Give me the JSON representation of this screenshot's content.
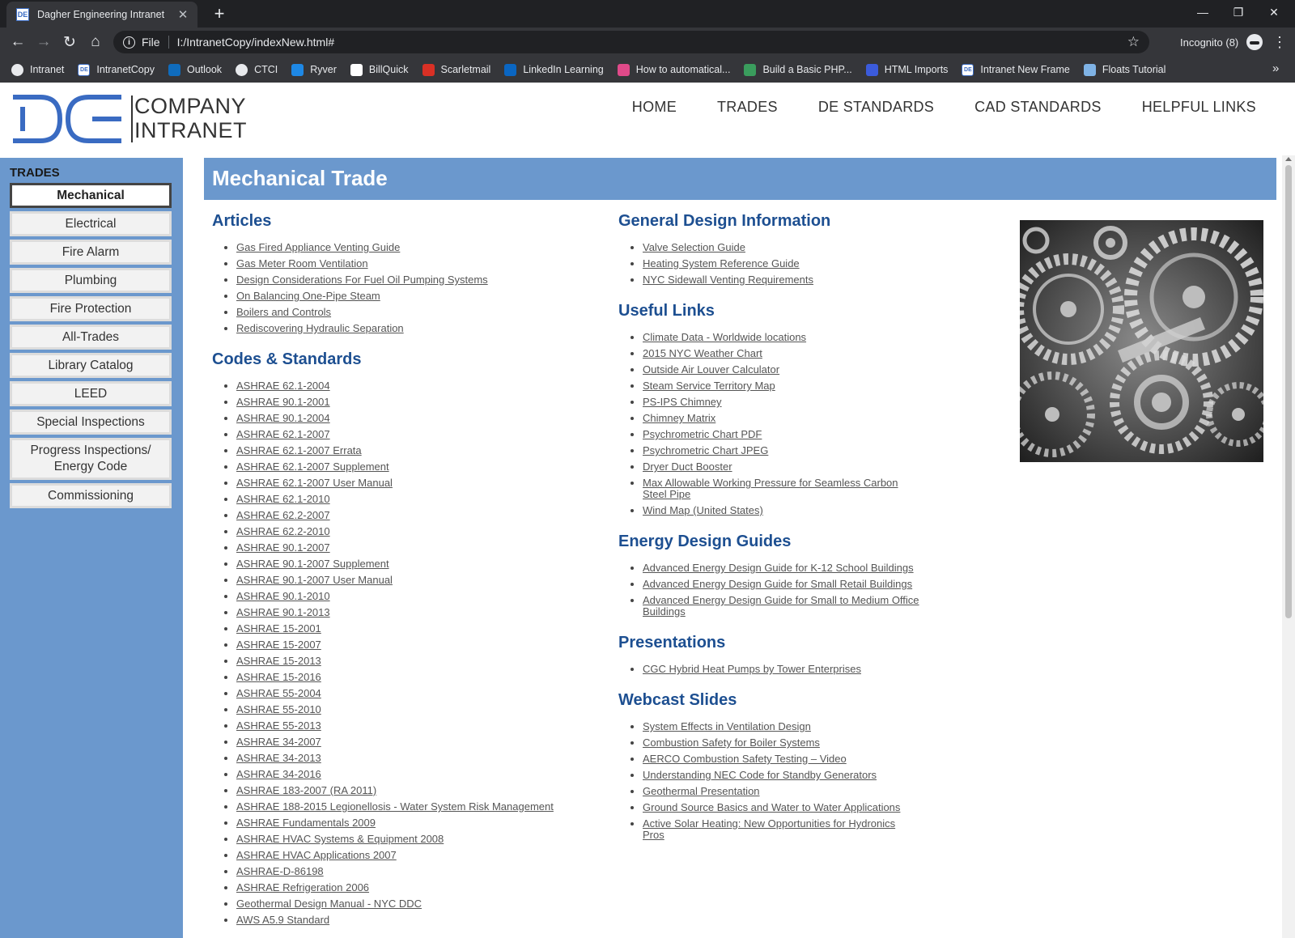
{
  "browser": {
    "tab_title": "Dagher Engineering Intranet",
    "favicon_text": "DE",
    "scheme_label": "File",
    "url": "I:/IntranetCopy/indexNew.html#",
    "incognito_label": "Incognito (8)"
  },
  "bookmarks": [
    {
      "label": "Intranet",
      "icon": "globe-icon",
      "color": "#e8eaed"
    },
    {
      "label": "IntranetCopy",
      "icon": "de-logo-icon",
      "color": "#ffffff"
    },
    {
      "label": "Outlook",
      "icon": "outlook-icon",
      "color": "#0f6cbd"
    },
    {
      "label": "CTCI",
      "icon": "globe-icon",
      "color": "#e8eaed"
    },
    {
      "label": "Ryver",
      "icon": "ryver-icon",
      "color": "#1e88e5"
    },
    {
      "label": "BillQuick",
      "icon": "billquick-icon",
      "color": "#ffffff"
    },
    {
      "label": "Scarletmail",
      "icon": "gmail-icon",
      "color": "#d93025"
    },
    {
      "label": "LinkedIn Learning",
      "icon": "linkedin-icon",
      "color": "#0a66c2"
    },
    {
      "label": "How to automatical...",
      "icon": "swirl-icon",
      "color": "#e04a8a"
    },
    {
      "label": "Build a Basic PHP...",
      "icon": "php-icon",
      "color": "#3a9d5d"
    },
    {
      "label": "HTML Imports",
      "icon": "html5-icon",
      "color": "#3b5bdb"
    },
    {
      "label": "Intranet New Frame",
      "icon": "de-logo-icon",
      "color": "#ffffff"
    },
    {
      "label": "Floats Tutorial",
      "icon": "floats-icon",
      "color": "#7fb3e6"
    }
  ],
  "logo": {
    "line1": "COMPANY",
    "line2": "INTRANET",
    "accent": "#3a6bc2"
  },
  "topnav": [
    "HOME",
    "TRADES",
    "DE STANDARDS",
    "CAD STANDARDS",
    "HELPFUL LINKS"
  ],
  "sidebar": {
    "title": "TRADES",
    "items": [
      {
        "label": "Mechanical",
        "active": true
      },
      {
        "label": "Electrical"
      },
      {
        "label": "Fire Alarm"
      },
      {
        "label": "Plumbing"
      },
      {
        "label": "Fire Protection"
      },
      {
        "label": "All-Trades"
      },
      {
        "label": "Library Catalog"
      },
      {
        "label": "LEED"
      },
      {
        "label": "Special Inspections"
      },
      {
        "label": "Progress Inspections/ Energy Code"
      },
      {
        "label": "Commissioning"
      }
    ]
  },
  "main": {
    "title": "Mechanical Trade",
    "accent": "#6b98cd",
    "heading_color": "#1d4f91",
    "col1": [
      {
        "heading": "Articles",
        "links": [
          "Gas Fired Appliance Venting Guide",
          "Gas Meter Room Ventilation",
          "Design Considerations For Fuel Oil Pumping Systems",
          "On Balancing One-Pipe Steam",
          "Boilers and Controls",
          "Rediscovering Hydraulic Separation"
        ]
      },
      {
        "heading": "Codes & Standards",
        "links": [
          "ASHRAE 62.1-2004",
          "ASHRAE 90.1-2001",
          "ASHRAE 90.1-2004",
          "ASHRAE 62.1-2007",
          "ASHRAE 62.1-2007 Errata",
          "ASHRAE 62.1-2007 Supplement",
          "ASHRAE 62.1-2007 User Manual",
          "ASHRAE 62.1-2010",
          "ASHRAE 62.2-2007",
          "ASHRAE 62.2-2010",
          "ASHRAE 90.1-2007",
          "ASHRAE 90.1-2007 Supplement",
          "ASHRAE 90.1-2007 User Manual",
          "ASHRAE 90.1-2010",
          "ASHRAE 90.1-2013",
          "ASHRAE 15-2001",
          "ASHRAE 15-2007",
          "ASHRAE 15-2013",
          "ASHRAE 15-2016",
          "ASHRAE 55-2004",
          "ASHRAE 55-2010",
          "ASHRAE 55-2013",
          "ASHRAE 34-2007",
          "ASHRAE 34-2013",
          "ASHRAE 34-2016",
          "ASHRAE 183-2007 (RA 2011)",
          "ASHRAE 188-2015 Legionellosis - Water System Risk Management",
          "ASHRAE Fundamentals 2009",
          "ASHRAE HVAC Systems & Equipment 2008",
          "ASHRAE HVAC Applications 2007",
          "ASHRAE-D-86198",
          "ASHRAE Refrigeration 2006",
          "Geothermal Design Manual - NYC DDC",
          "AWS A5.9 Standard"
        ]
      }
    ],
    "col2": [
      {
        "heading": "General Design Information",
        "links": [
          "Valve Selection Guide",
          "Heating System Reference Guide",
          "NYC Sidewall Venting Requirements"
        ]
      },
      {
        "heading": "Useful Links",
        "links": [
          "Climate Data - Worldwide locations",
          "2015 NYC Weather Chart",
          "Outside Air Louver Calculator",
          "Steam Service Territory Map",
          "PS-IPS Chimney",
          "Chimney Matrix",
          "Psychrometric Chart PDF",
          "Psychrometric Chart JPEG",
          "Dryer Duct Booster",
          "Max Allowable Working Pressure for Seamless Carbon Steel Pipe",
          "Wind Map (United States)"
        ]
      },
      {
        "heading": "Energy Design Guides",
        "links": [
          "Advanced Energy Design Guide for K-12 School Buildings",
          "Advanced Energy Design Guide for Small Retail Buildings",
          "Advanced Energy Design Guide for Small to Medium Office Buildings"
        ]
      },
      {
        "heading": "Presentations",
        "links": [
          "CGC Hybrid Heat Pumps by Tower Enterprises"
        ]
      },
      {
        "heading": "Webcast Slides",
        "links": [
          "System Effects in Ventilation Design",
          "Combustion Safety for Boiler Systems",
          "AERCO Combustion Safety Testing – Video",
          "Understanding NEC Code for Standby Generators",
          "Geothermal Presentation",
          "Ground Source Basics and Water to Water Applications",
          "Active Solar Heating: New Opportunities for Hydronics Pros"
        ]
      }
    ]
  }
}
